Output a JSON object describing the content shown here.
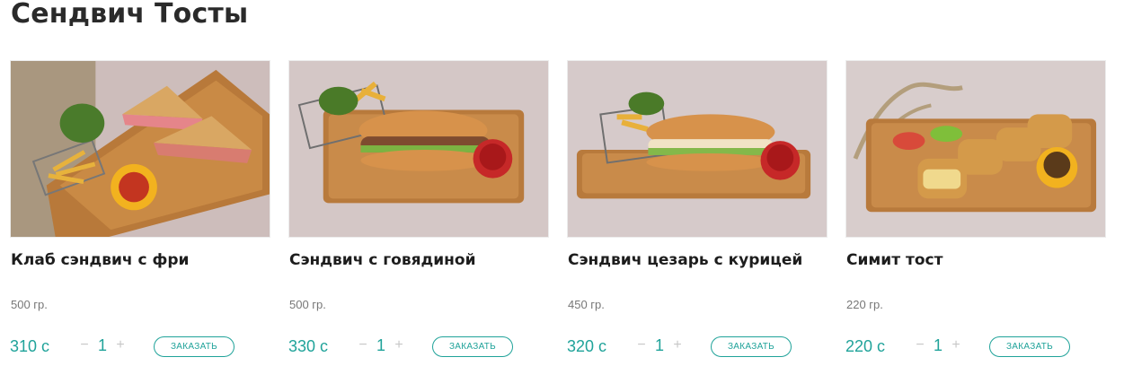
{
  "section": {
    "title": "Сендвич Тосты"
  },
  "colors": {
    "accent": "#20a39a",
    "text": "#1d1d1d",
    "muted": "#777777"
  },
  "stepper": {
    "minus": "−",
    "plus": "+"
  },
  "products": [
    {
      "name": "Клаб сэндвич с фри",
      "weight": "500 гр.",
      "price": "310 с",
      "qty": "1",
      "order_label": "ЗАКАЗАТЬ"
    },
    {
      "name": "Сэндвич с говядиной",
      "weight": "500 гр.",
      "price": "330 с",
      "qty": "1",
      "order_label": "ЗАКАЗАТЬ"
    },
    {
      "name": "Сэндвич цезарь с курицей",
      "weight": "450 гр.",
      "price": "320 с",
      "qty": "1",
      "order_label": "ЗАКАЗАТЬ"
    },
    {
      "name": "Симит тост",
      "weight": "220 гр.",
      "price": "220 с",
      "qty": "1",
      "order_label": "ЗАКАЗАТЬ"
    }
  ]
}
